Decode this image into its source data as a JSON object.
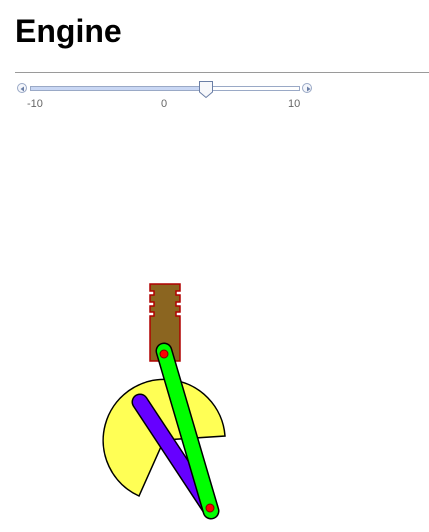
{
  "page": {
    "title": "Engine"
  },
  "slider": {
    "min_label": "-10",
    "mid_label": "0",
    "max_label": "10",
    "value_fraction": 0.65
  },
  "colors": {
    "piston_body": "#8b6520",
    "piston_outline": "#b00000",
    "rod_fill": "#00ff00",
    "crank_fill": "#6600ff",
    "flywheel_fill": "#ffff55",
    "pin_fill": "#ff0000",
    "outline": "#000000"
  },
  "icons": {
    "left_arrow": "arrow-left-icon",
    "right_arrow": "arrow-right-icon",
    "thumb": "slider-thumb-icon"
  }
}
